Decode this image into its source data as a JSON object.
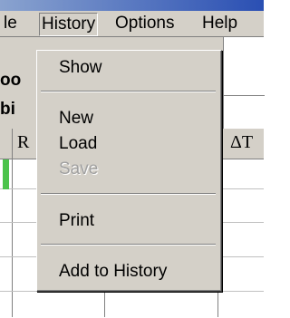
{
  "menubar": {
    "items": [
      {
        "label": "le"
      },
      {
        "label": "History"
      },
      {
        "label": "Options"
      },
      {
        "label": "Help"
      }
    ]
  },
  "background": {
    "row1": "oo",
    "row2": "bi",
    "grid_header_left": "R",
    "grid_header_right": "ΔT"
  },
  "history_menu": {
    "items": [
      {
        "label": "Show",
        "enabled": true
      },
      {
        "label": "New",
        "enabled": true
      },
      {
        "label": "Load",
        "enabled": true
      },
      {
        "label": "Save",
        "enabled": false
      },
      {
        "label": "Print",
        "enabled": true
      },
      {
        "label": "Add to History",
        "enabled": true
      }
    ]
  }
}
